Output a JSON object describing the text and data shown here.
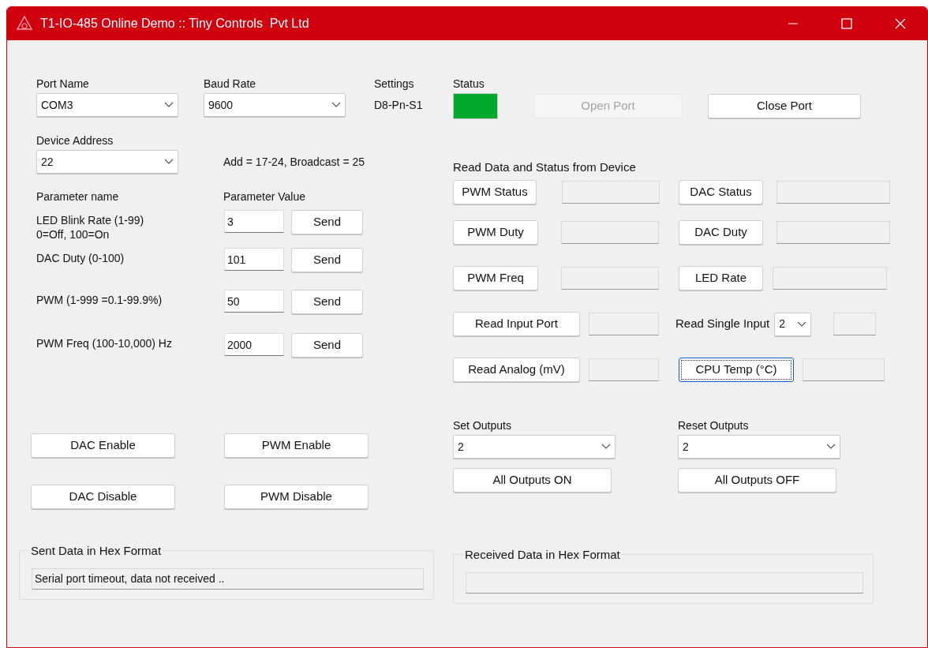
{
  "window": {
    "title": "T1-IO-485 Online Demo :: Tiny Controls  Pvt Ltd"
  },
  "port_name": {
    "label": "Port Name",
    "value": "COM3"
  },
  "baud_rate": {
    "label": "Baud Rate",
    "value": "9600"
  },
  "settings": {
    "label": "Settings",
    "value": "D8-Pn-S1"
  },
  "status": {
    "label": "Status",
    "connected": true
  },
  "open_port": {
    "label": "Open Port",
    "disabled": true
  },
  "close_port": {
    "label": "Close Port",
    "disabled": false
  },
  "device_address": {
    "label": "Device Address",
    "value": "22",
    "hint": "Add = 17-24, Broadcast = 25"
  },
  "parameters": {
    "name_heading": "Parameter name",
    "value_heading": "Parameter Value",
    "rows": [
      {
        "name": "LED Blink Rate (1-99)",
        "note": "0=Off, 100=On",
        "value": "3",
        "button": "Send"
      },
      {
        "name": "DAC Duty (0-100)",
        "value": "101",
        "button": "Send"
      },
      {
        "name": "PWM (1-999 =0.1-99.9%)",
        "value": "50",
        "button": "Send"
      },
      {
        "name": "PWM Freq (100-10,000) Hz",
        "value": "2000",
        "button": "Send"
      }
    ]
  },
  "enable_buttons": [
    {
      "label": "DAC Enable"
    },
    {
      "label": "PWM Enable"
    },
    {
      "label": "DAC Disable"
    },
    {
      "label": "PWM Disable"
    }
  ],
  "read": {
    "title": "Read Data and Status from Device",
    "items": [
      {
        "kind": "button",
        "label": "PWM Status",
        "focused": false
      },
      {
        "kind": "button",
        "label": "DAC Status",
        "focused": false
      },
      {
        "kind": "button",
        "label": "PWM Duty",
        "focused": false
      },
      {
        "kind": "button",
        "label": "DAC Duty",
        "focused": false
      },
      {
        "kind": "button",
        "label": "PWM Freq",
        "focused": false
      },
      {
        "kind": "button",
        "label": "LED Rate",
        "focused": false
      },
      {
        "kind": "button",
        "label": "Read Input Port",
        "focused": false
      },
      {
        "kind": "select",
        "label": "Read Single Input",
        "value": "2"
      },
      {
        "kind": "button",
        "label": "Read Analog (mV)",
        "focused": false
      },
      {
        "kind": "button",
        "label": "CPU Temp (°C)",
        "focused": true
      }
    ]
  },
  "set_outputs": {
    "label": "Set Outputs",
    "value": "2",
    "button": "All Outputs ON"
  },
  "reset_outputs": {
    "label": "Reset Outputs",
    "value": "2",
    "button": "All Outputs OFF"
  },
  "sent_data": {
    "title": "Sent Data in Hex Format",
    "value": "Serial port timeout, data not received .."
  },
  "received_data": {
    "title": "Received Data in Hex Format"
  }
}
